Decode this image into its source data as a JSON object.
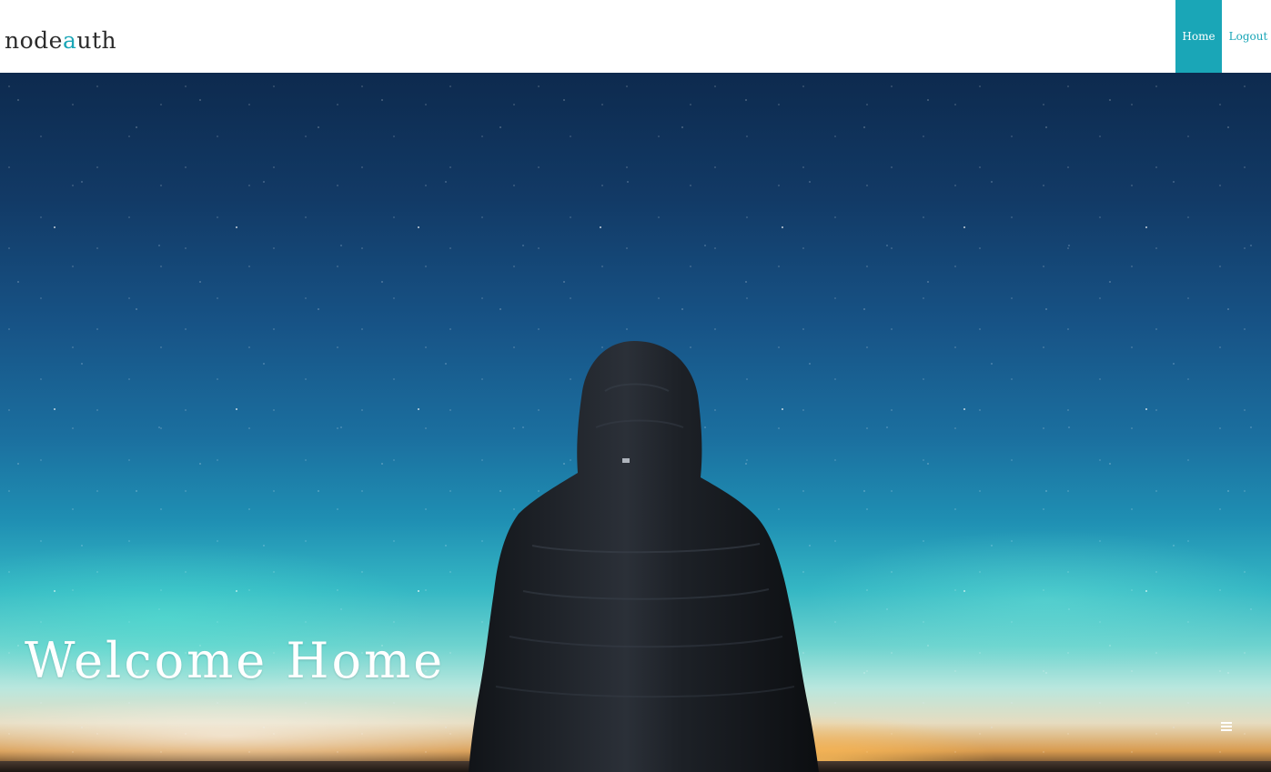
{
  "navbar": {
    "logo": {
      "part1": "node",
      "accent": "a",
      "part2": "uth"
    },
    "links": {
      "home": "Home",
      "logout": "Logout"
    },
    "active_link": "Home"
  },
  "hero": {
    "title": "Welcome Home"
  },
  "icons": {
    "menu": "hamburger-menu-icon"
  },
  "colors": {
    "accent": "#1aa6b7",
    "logo_text": "#2b2b2b",
    "hero_title": "#ffffff"
  }
}
